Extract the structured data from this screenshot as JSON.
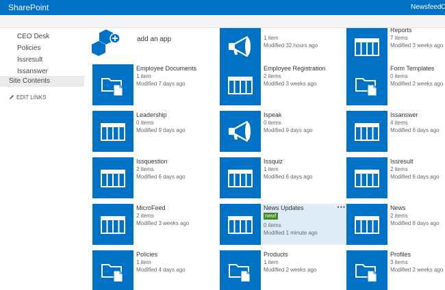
{
  "header": {
    "brand": "SharePoint",
    "newsfeed": "Newsfeed",
    "overflow": "C"
  },
  "leftnav": {
    "items": [
      "CEO Desk",
      "Policies",
      "Issresult",
      "Issanswer",
      "Site Contents"
    ],
    "edit_links": "EDIT LINKS"
  },
  "add_app": {
    "label": "add an app"
  },
  "tiles": [
    {
      "icon": "megaphone",
      "title": "",
      "count": "1 item",
      "modified": "Modified 32 hours ago"
    },
    {
      "icon": "table",
      "title": "Reports",
      "count": "7 items",
      "modified": "Modified 3 weeks ago"
    },
    {
      "icon": "folder",
      "title": "Employee Documents",
      "count": "1 item",
      "modified": "Modified 7 days ago"
    },
    {
      "icon": "table",
      "title": "Employee Registration",
      "count": "2 items",
      "modified": "Modified 3 weeks ago"
    },
    {
      "icon": "folder",
      "title": "Form Templates",
      "count": "0 items",
      "modified": "Modified 2 weeks ago"
    },
    {
      "icon": "table",
      "title": "Leadership",
      "count": "0 items",
      "modified": "Modified 9 days ago"
    },
    {
      "icon": "megaphone",
      "title": "Ispeak",
      "count": "0 items",
      "modified": "Modified 9 days ago"
    },
    {
      "icon": "table",
      "title": "Issanswer",
      "count": "4 items",
      "modified": "Modified 6 days ago"
    },
    {
      "icon": "table",
      "title": "Issquestion",
      "count": "2 items",
      "modified": "Modified 6 days ago"
    },
    {
      "icon": "table",
      "title": "Issquiz",
      "count": "1 item",
      "modified": "Modified 6 days ago"
    },
    {
      "icon": "table",
      "title": "Issresult",
      "count": "2 items",
      "modified": "Modified 6 days ago"
    },
    {
      "icon": "table",
      "title": "MicroFeed",
      "count": "2 items",
      "modified": "Modified 3 weeks ago"
    },
    {
      "icon": "table",
      "title": "News Updates",
      "badge": "new!",
      "count": "0 items",
      "modified": "Modified 1 minute ago",
      "menu": "•••"
    },
    {
      "icon": "table",
      "title": "News",
      "count": "2 items",
      "modified": "Modified 8 days ago"
    },
    {
      "icon": "folder",
      "title": "Policies",
      "count": "1 item",
      "modified": "Modified 4 days ago"
    },
    {
      "icon": "folder",
      "title": "Products",
      "count": "1 item",
      "modified": "Modified 2 weeks ago"
    },
    {
      "icon": "folder",
      "title": "Profiles",
      "count": "3 items",
      "modified": "Modified 2 weeks ago"
    }
  ],
  "colors": {
    "accent": "#0072c6",
    "new_badge": "#3a8a1e",
    "highlight": "#deecf9"
  }
}
